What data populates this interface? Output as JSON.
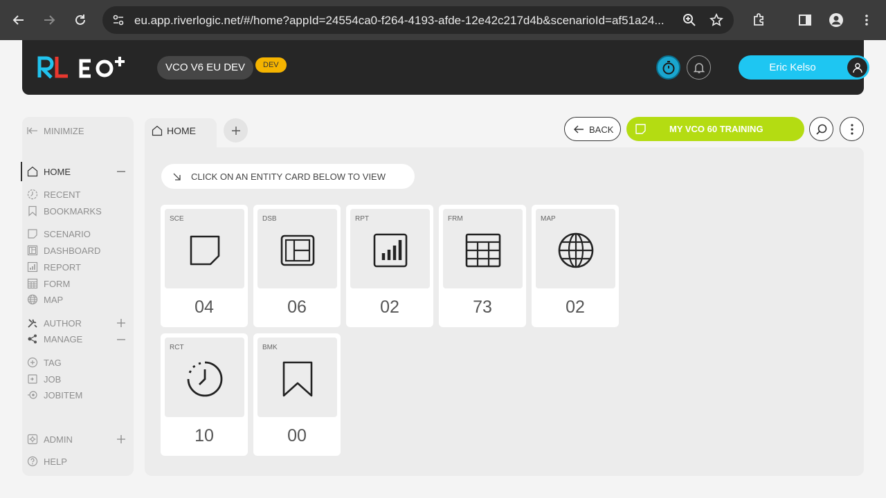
{
  "browser": {
    "url": "eu.app.riverlogic.net/#/home?appId=24554ca0-f264-4193-afde-12e42c217d4b&scenarioId=af51a24..."
  },
  "header": {
    "app_name": "VCO V6 EU DEV",
    "env_badge": "DEV",
    "user_name": "Eric Kelso",
    "accent_color": "#1ec6f2"
  },
  "sidebar": {
    "minimize": "MINIMIZE",
    "items": [
      {
        "label": "HOME"
      },
      {
        "label": "RECENT"
      },
      {
        "label": "BOOKMARKS"
      },
      {
        "label": "SCENARIO"
      },
      {
        "label": "DASHBOARD"
      },
      {
        "label": "REPORT"
      },
      {
        "label": "FORM"
      },
      {
        "label": "MAP"
      },
      {
        "label": "AUTHOR"
      },
      {
        "label": "MANAGE"
      },
      {
        "label": "TAG"
      },
      {
        "label": "JOB"
      },
      {
        "label": "JOBITEM"
      },
      {
        "label": "ADMIN"
      },
      {
        "label": "HELP"
      }
    ]
  },
  "tabs": {
    "home": "HOME"
  },
  "toolbar": {
    "back": "BACK",
    "training": "MY VCO 60 TRAINING",
    "training_color": "#b4dc12"
  },
  "main": {
    "hint": "CLICK ON AN ENTITY CARD BELOW TO VIEW",
    "cards": [
      {
        "code": "SCE",
        "count": "04",
        "icon": "scenario-icon"
      },
      {
        "code": "DSB",
        "count": "06",
        "icon": "dashboard-icon"
      },
      {
        "code": "RPT",
        "count": "02",
        "icon": "report-icon"
      },
      {
        "code": "FRM",
        "count": "73",
        "icon": "form-icon"
      },
      {
        "code": "MAP",
        "count": "02",
        "icon": "globe-icon"
      },
      {
        "code": "RCT",
        "count": "10",
        "icon": "recent-icon"
      },
      {
        "code": "BMK",
        "count": "00",
        "icon": "bookmark-icon"
      }
    ]
  }
}
